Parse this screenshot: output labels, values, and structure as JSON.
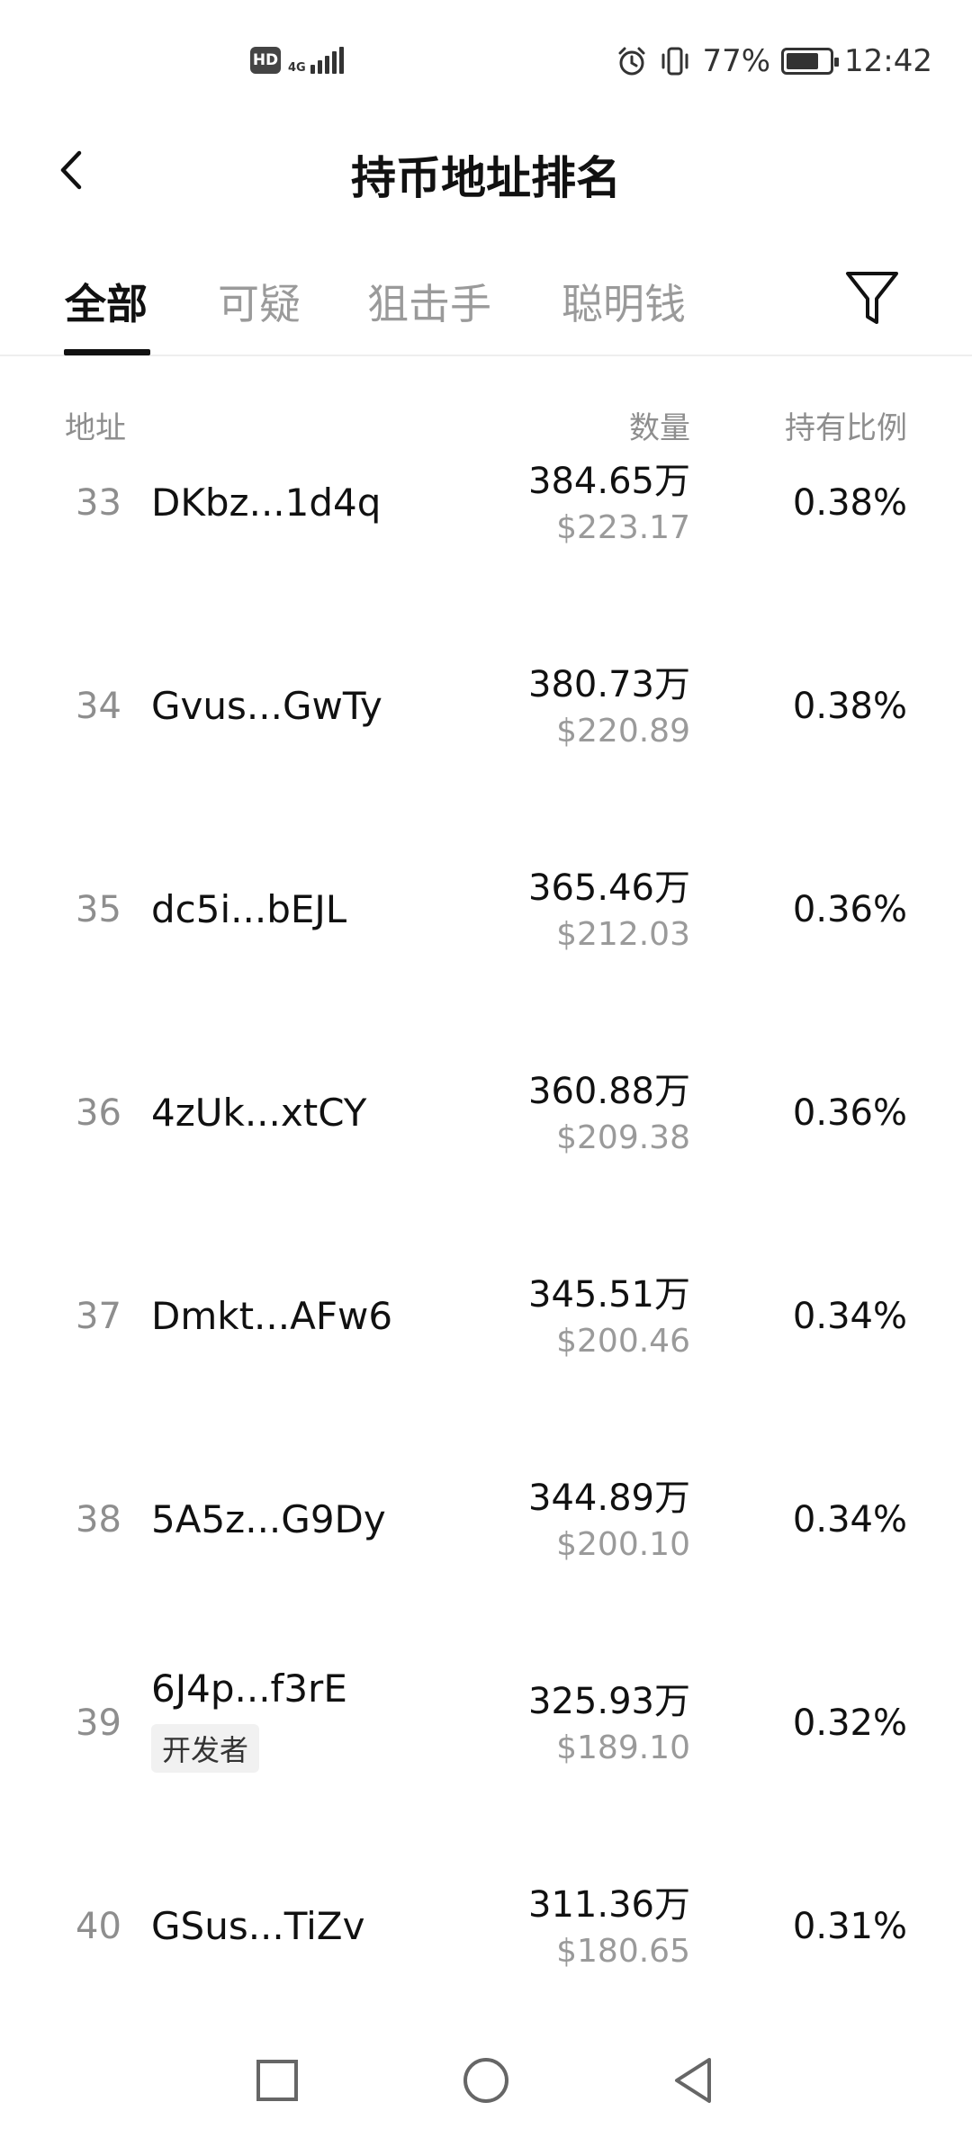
{
  "status_bar": {
    "hd": "HD",
    "network": "4G",
    "battery_percent": "77%",
    "battery_level": 0.77,
    "time": "12:42"
  },
  "header": {
    "title": "持币地址排名"
  },
  "tabs": [
    {
      "label": "全部",
      "active": true
    },
    {
      "label": "可疑",
      "active": false
    },
    {
      "label": "狙击手",
      "active": false
    },
    {
      "label": "聪明钱",
      "active": false
    }
  ],
  "columns": {
    "address": "地址",
    "quantity": "数量",
    "ratio": "持有比例"
  },
  "rows": [
    {
      "rank": "33",
      "address": "DKbz...1d4q",
      "quantity": "384.65万",
      "usd": "$223.17",
      "ratio": "0.38%"
    },
    {
      "rank": "34",
      "address": "Gvus...GwTy",
      "quantity": "380.73万",
      "usd": "$220.89",
      "ratio": "0.38%"
    },
    {
      "rank": "35",
      "address": "dc5i...bEJL",
      "quantity": "365.46万",
      "usd": "$212.03",
      "ratio": "0.36%"
    },
    {
      "rank": "36",
      "address": "4zUk...xtCY",
      "quantity": "360.88万",
      "usd": "$209.38",
      "ratio": "0.36%"
    },
    {
      "rank": "37",
      "address": "Dmkt...AFw6",
      "quantity": "345.51万",
      "usd": "$200.46",
      "ratio": "0.34%"
    },
    {
      "rank": "38",
      "address": "5A5z...G9Dy",
      "quantity": "344.89万",
      "usd": "$200.10",
      "ratio": "0.34%"
    },
    {
      "rank": "39",
      "address": "6J4p...f3rE",
      "tag": "开发者",
      "quantity": "325.93万",
      "usd": "$189.10",
      "ratio": "0.32%"
    },
    {
      "rank": "40",
      "address": "GSus...TiZv",
      "quantity": "311.36万",
      "usd": "$180.65",
      "ratio": "0.31%"
    }
  ],
  "icons": {
    "back": "back-chevron-icon",
    "filter": "filter-funnel-icon",
    "alarm": "alarm-icon",
    "vibrate": "vibrate-icon",
    "nav_recent": "square-icon",
    "nav_home": "circle-icon",
    "nav_back": "triangle-back-icon"
  }
}
